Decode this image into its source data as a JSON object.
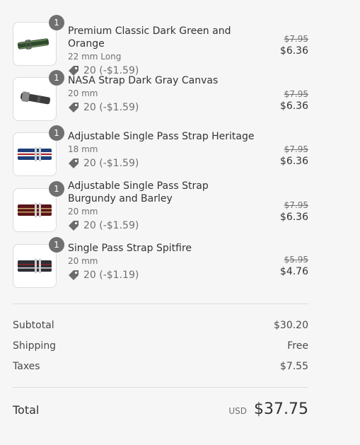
{
  "items": [
    {
      "name": "Premium Classic Dark Green and Orange",
      "variant": "22 mm Long",
      "quantity": "1",
      "discount": "20 (-$1.59)",
      "price_old": "$7.95",
      "price_new": "$6.36",
      "image_icon": "green-leather-strap-image"
    },
    {
      "name": "NASA Strap Dark Gray Canvas",
      "variant": "20 mm",
      "quantity": "1",
      "discount": "20 (-$1.59)",
      "price_old": "$7.95",
      "price_new": "$6.36",
      "image_icon": "gray-canvas-strap-image"
    },
    {
      "name": "Adjustable Single Pass Strap Heritage",
      "variant": "18 mm",
      "quantity": "1",
      "discount": "20 (-$1.59)",
      "price_old": "$7.95",
      "price_new": "$6.36",
      "image_icon": "blue-white-nato-strap-image"
    },
    {
      "name": "Adjustable Single Pass Strap Burgundy and Barley",
      "variant": "20 mm",
      "quantity": "1",
      "discount": "20 (-$1.59)",
      "price_old": "$7.95",
      "price_new": "$6.36",
      "image_icon": "burgundy-nato-strap-image"
    },
    {
      "name": "Single Pass Strap Spitfire",
      "variant": "20 mm",
      "quantity": "1",
      "discount": "20 (-$1.19)",
      "price_old": "$5.95",
      "price_new": "$4.76",
      "image_icon": "spitfire-nato-strap-image"
    }
  ],
  "totals": {
    "subtotal_label": "Subtotal",
    "subtotal_value": "$30.20",
    "shipping_label": "Shipping",
    "shipping_value": "Free",
    "taxes_label": "Taxes",
    "taxes_value": "$7.55",
    "total_label": "Total",
    "currency": "USD",
    "total_value": "$37.75"
  },
  "colors": {
    "background": "#f6f6f6",
    "badge": "#707070",
    "text": "#333333",
    "muted": "#717171"
  }
}
